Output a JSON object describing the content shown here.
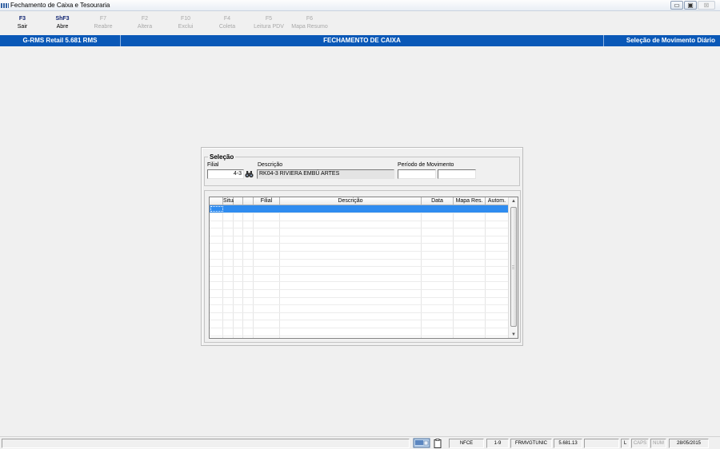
{
  "window": {
    "title": "Fechamento de Caixa e Tesouraria",
    "controls": {
      "minimize": "▭",
      "maximize": "▣",
      "close": "⊠"
    }
  },
  "toolbar": {
    "keys": [
      {
        "key": "F3",
        "label": "Sair",
        "enabled": true
      },
      {
        "key": "ShF3",
        "label": "Abre",
        "enabled": true
      },
      {
        "key": "F7",
        "label": "Reabre",
        "enabled": false
      },
      {
        "key": "F2",
        "label": "Altera",
        "enabled": false
      },
      {
        "key": "F10",
        "label": "Exclui",
        "enabled": false
      },
      {
        "key": "F4",
        "label": "Coleta",
        "enabled": false
      },
      {
        "key": "F5",
        "label": "Leitura PDV",
        "enabled": false
      },
      {
        "key": "F6",
        "label": "Mapa Resumo",
        "enabled": false
      }
    ]
  },
  "header": {
    "system": "G-RMS Retail 5.681 RMS",
    "screen": "FECHAMENTO DE CAIXA",
    "context": "Seleção de Movimento Diário"
  },
  "selection": {
    "legend": "Seleção",
    "filial_label": "Filial",
    "filial_value": "4-3",
    "descricao_label": "Descrição",
    "descricao_value": "RK04-3 RIVIERA EMBÚ ARTES",
    "periodo_label": "Período de Movimento",
    "periodo_inicio": "",
    "periodo_fim": ""
  },
  "grid": {
    "columns": [
      "",
      "Situação",
      "",
      "",
      "Filial",
      "Descrição",
      "Data",
      "Mapa Res.",
      "Autom."
    ],
    "rows": []
  },
  "statusbar": {
    "cells": [
      "NFCE",
      "1-9",
      "FRMVGTUNIC",
      "5.681.13",
      "",
      "L",
      "CAPS",
      "NUM",
      "28/05/2015"
    ]
  },
  "colors": {
    "header_blue": "#0a58b7",
    "selection_blue": "#2f8cf0",
    "fkey_active": "#0a1e6e"
  }
}
